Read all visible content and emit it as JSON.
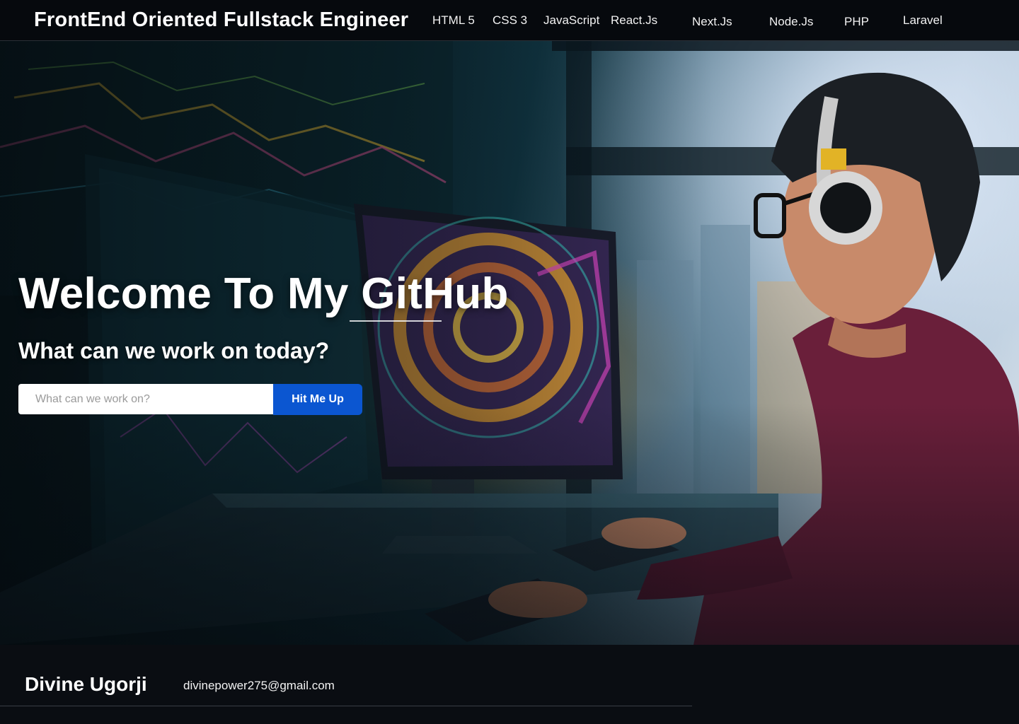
{
  "header": {
    "title": "FrontEnd Oriented Fullstack Engineer",
    "nav": [
      {
        "label": "HTML 5"
      },
      {
        "label": "CSS 3"
      },
      {
        "label": "JavaScript"
      },
      {
        "label": "React.Js"
      },
      {
        "label": "Next.Js"
      },
      {
        "label": "Node.Js"
      },
      {
        "label": "PHP"
      },
      {
        "label": "Laravel"
      }
    ]
  },
  "hero": {
    "heading": "Welcome To My GitHub",
    "subheading": "What can we work on today?",
    "search": {
      "placeholder": "What can we work on?",
      "value": ""
    },
    "button_label": "Hit Me Up"
  },
  "footer": {
    "name": "Divine Ugorji",
    "email": "divinepower275@gmail.com"
  },
  "colors": {
    "accent": "#0b56d1",
    "header_bg": "#06090d",
    "footer_bg": "#0a0d12"
  }
}
